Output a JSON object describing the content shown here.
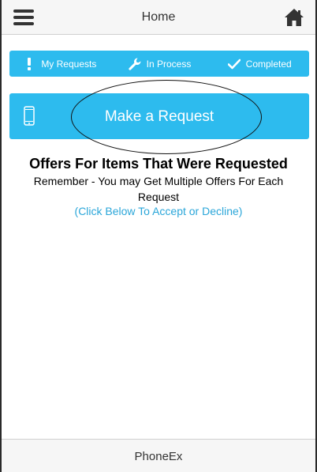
{
  "header": {
    "title": "Home",
    "menu_icon": "hamburger-menu-icon",
    "home_icon": "home-icon"
  },
  "status_tabs": [
    {
      "label": "My Requests",
      "icon": "exclamation-icon"
    },
    {
      "label": "In Process",
      "icon": "wrench-icon"
    },
    {
      "label": "Completed",
      "icon": "checkmark-icon"
    }
  ],
  "request": {
    "label": "Make a Request",
    "icon": "mobile-phone-icon"
  },
  "offers": {
    "title": "Offers For Items That Were Requested",
    "subtitle": "Remember - You may Get Multiple Offers For Each Request",
    "link": "(Click Below To Accept or Decline)"
  },
  "footer": {
    "title": "PhoneEx"
  },
  "colors": {
    "accent": "#2dbbee",
    "link": "#2aa6d9",
    "header_bg": "#f6f6f6",
    "text": "#333333"
  }
}
